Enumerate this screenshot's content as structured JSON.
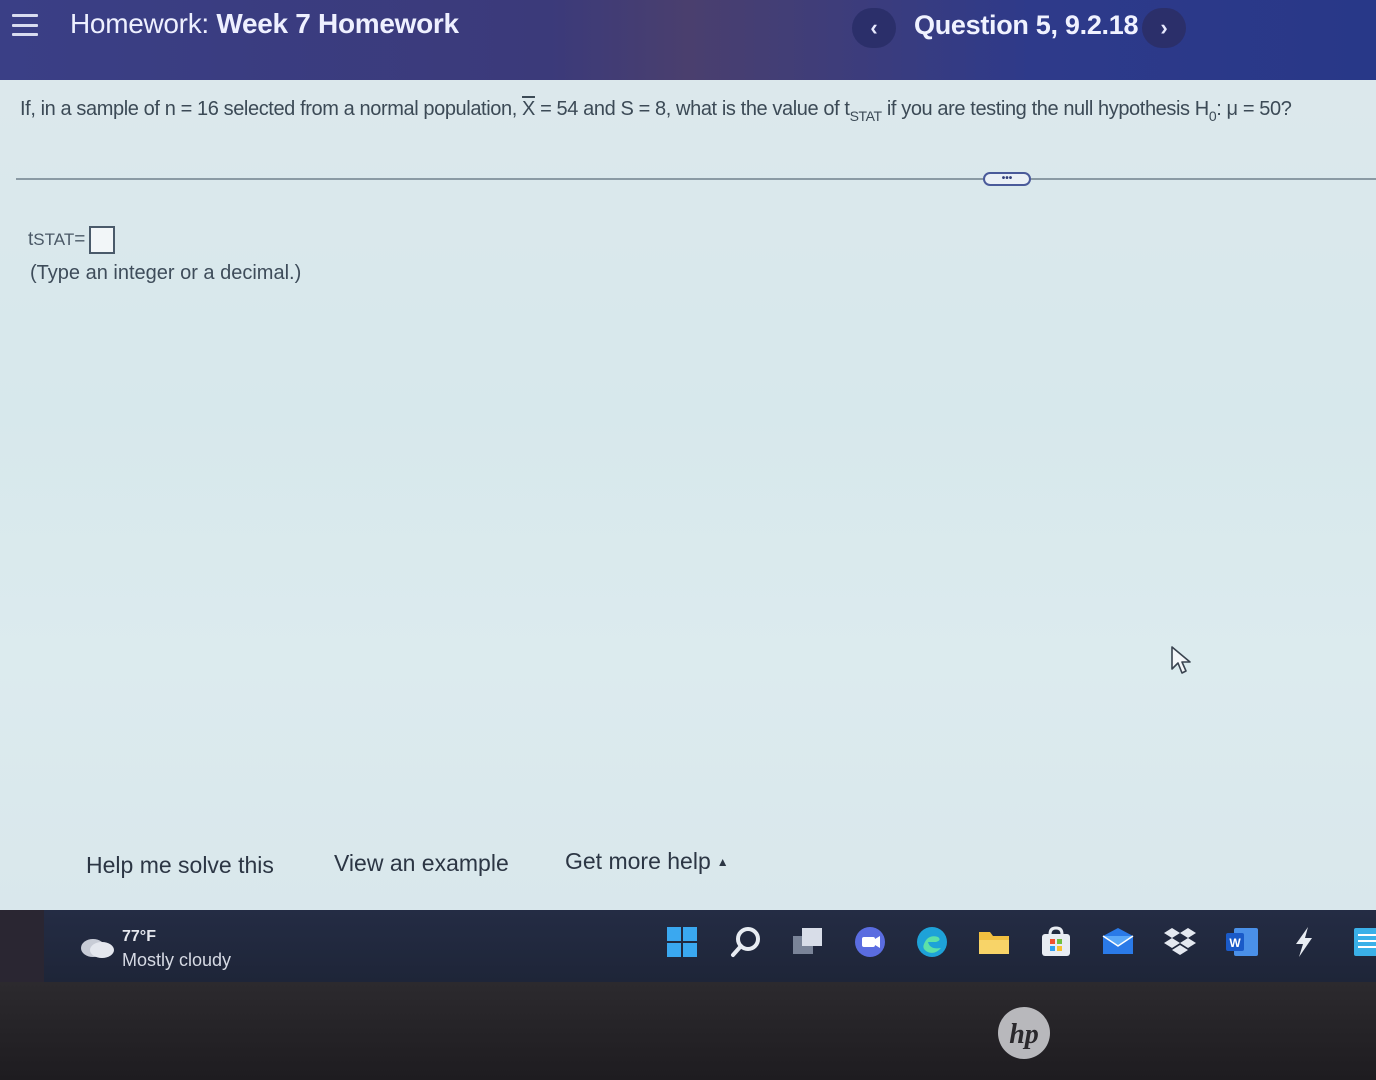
{
  "header": {
    "title_prefix": "Homework:",
    "title_name": "Week 7 Homework",
    "prev_label": "‹",
    "next_label": "›",
    "question_label": "Question 5, 9.2.18"
  },
  "question": {
    "part1": "If, in a sample of n = 16 selected from a normal population, ",
    "xbar_symbol": "X",
    "part2": " = 54 and S = 8, what is the value of t",
    "tstat_sub": "STAT",
    "part3": " if you are testing the null hypothesis H",
    "h0_sub": "0",
    "part4": ": μ = 50?"
  },
  "expand_label": "•••",
  "answer": {
    "t_label": "t",
    "t_sub": "STAT",
    "equals": " =",
    "value": "",
    "hint": "(Type an integer or a decimal.)"
  },
  "help": {
    "solve": "Help me solve this",
    "example": "View an example",
    "more": "Get more help",
    "more_caret": "▲"
  },
  "taskbar": {
    "weather_temp": "77°F",
    "weather_desc": "Mostly cloudy",
    "apps": [
      "start-icon",
      "search-icon",
      "task-view-icon",
      "chat-icon",
      "edge-icon",
      "file-explorer-icon",
      "store-icon",
      "mail-icon",
      "dropbox-icon",
      "word-icon",
      "app-icon",
      "notes-icon"
    ]
  },
  "bezel": {
    "brand": "hp"
  },
  "colors": {
    "header_bg": "#3a3f86",
    "content_bg": "#dce8ec",
    "taskbar_bg": "#242c44"
  }
}
